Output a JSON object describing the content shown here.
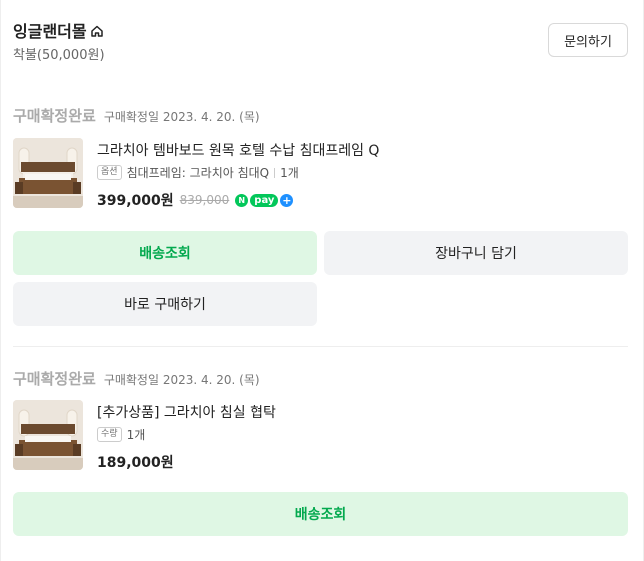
{
  "store": {
    "name": "잉글랜더몰",
    "icon": "home-icon",
    "payment_info": "착불(50,000원)",
    "inquiry_label": "문의하기"
  },
  "orders": [
    {
      "status": "구매확정완료",
      "date": "구매확정일 2023. 4. 20. (목)",
      "product_name": "그라치아 템바보드 원목 호텔 수납 침대프레임 Q",
      "option_tag": "옵션",
      "option_text": "침대프레임: 그라치아 침대Q",
      "quantity": "1개",
      "price": "399,000원",
      "original_price": "839,000",
      "npay": {
        "n": "N",
        "pay": "pay",
        "plus": "+"
      },
      "buttons": {
        "track": "배송조회",
        "cart": "장바구니 담기",
        "buy_now": "바로 구매하기"
      }
    },
    {
      "status": "구매확정완료",
      "date": "구매확정일 2023. 4. 20. (목)",
      "product_name": "[추가상품] 그라치아 침실 협탁",
      "option_tag": "수량",
      "quantity": "1개",
      "price": "189,000원",
      "buttons": {
        "track": "배송조회"
      }
    }
  ],
  "colors": {
    "accent_green": "#03a94e",
    "green_button_bg": "#dff7e4",
    "gray_button_bg": "#f2f3f5",
    "status_gray": "#aaaaaa",
    "npay_green": "#03c75a"
  }
}
